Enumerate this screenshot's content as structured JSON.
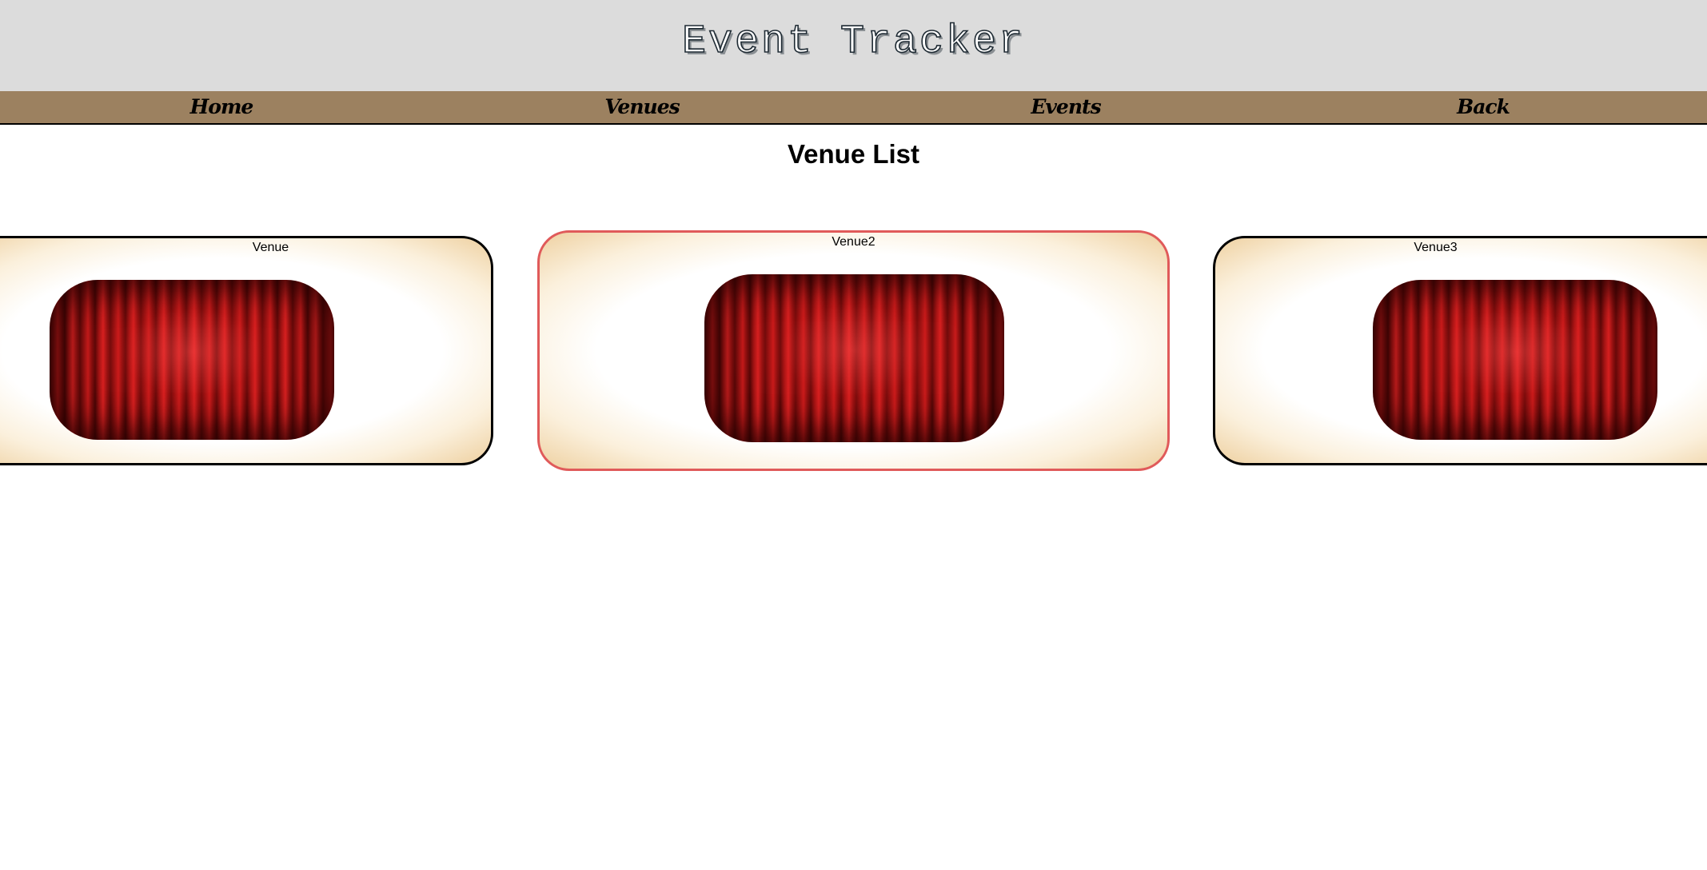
{
  "app": {
    "title": "Event Tracker"
  },
  "nav": {
    "items": [
      {
        "label": "Home"
      },
      {
        "label": "Venues"
      },
      {
        "label": "Events"
      },
      {
        "label": "Back"
      }
    ]
  },
  "page": {
    "heading": "Venue List"
  },
  "venues": [
    {
      "name": "Venue",
      "image": "curtain-image",
      "selected": false
    },
    {
      "name": "Venue2",
      "image": "curtain-image",
      "selected": true
    },
    {
      "name": "Venue3",
      "image": "curtain-image",
      "selected": false
    }
  ],
  "colors": {
    "header_bg": "#dcdcdc",
    "nav_bg": "#9c8160",
    "selected_border": "#e05a5a",
    "card_border": "#000000"
  }
}
